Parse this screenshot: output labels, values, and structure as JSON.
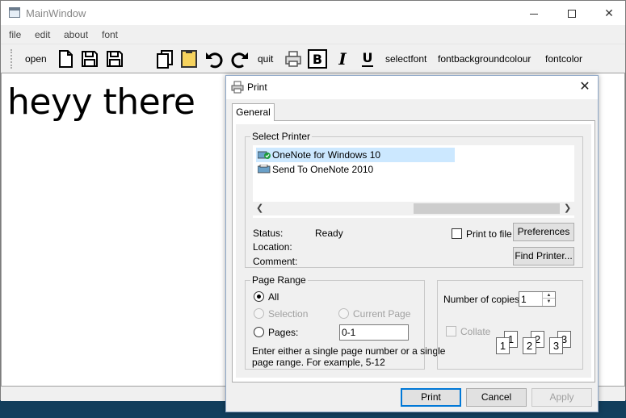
{
  "main_window": {
    "title": "MainWindow",
    "menu": [
      "file",
      "edit",
      "about",
      "font"
    ],
    "toolbar": {
      "open": "open",
      "quit": "quit",
      "selectfont": "selectfont",
      "fontbackgroundcolour": "fontbackgroundcolour",
      "fontcolor": "fontcolor"
    },
    "editor_text": "heyy there"
  },
  "print_dialog": {
    "title": "Print",
    "tab": "General",
    "select_printer": {
      "legend": "Select Printer",
      "printers": [
        "OneNote for Windows 10",
        "Send To OneNote 2010"
      ],
      "selected_index": 0
    },
    "status_label": "Status:",
    "status_value": "Ready",
    "location_label": "Location:",
    "comment_label": "Comment:",
    "print_to_file": "Print to file",
    "preferences": "Preferences",
    "find_printer": "Find Printer...",
    "page_range": {
      "legend": "Page Range",
      "all": "All",
      "selection": "Selection",
      "current_page": "Current Page",
      "pages": "Pages:",
      "pages_value": "0-1",
      "hint_line1": "Enter either a single page number or a single",
      "hint_line2": "page range.  For example, 5-12"
    },
    "copies": {
      "label": "Number of copies:",
      "value": "1",
      "collate": "Collate",
      "pages_glyphs": [
        "1",
        "1",
        "2",
        "2",
        "3",
        "3"
      ]
    },
    "buttons": {
      "print": "Print",
      "cancel": "Cancel",
      "apply": "Apply"
    }
  }
}
